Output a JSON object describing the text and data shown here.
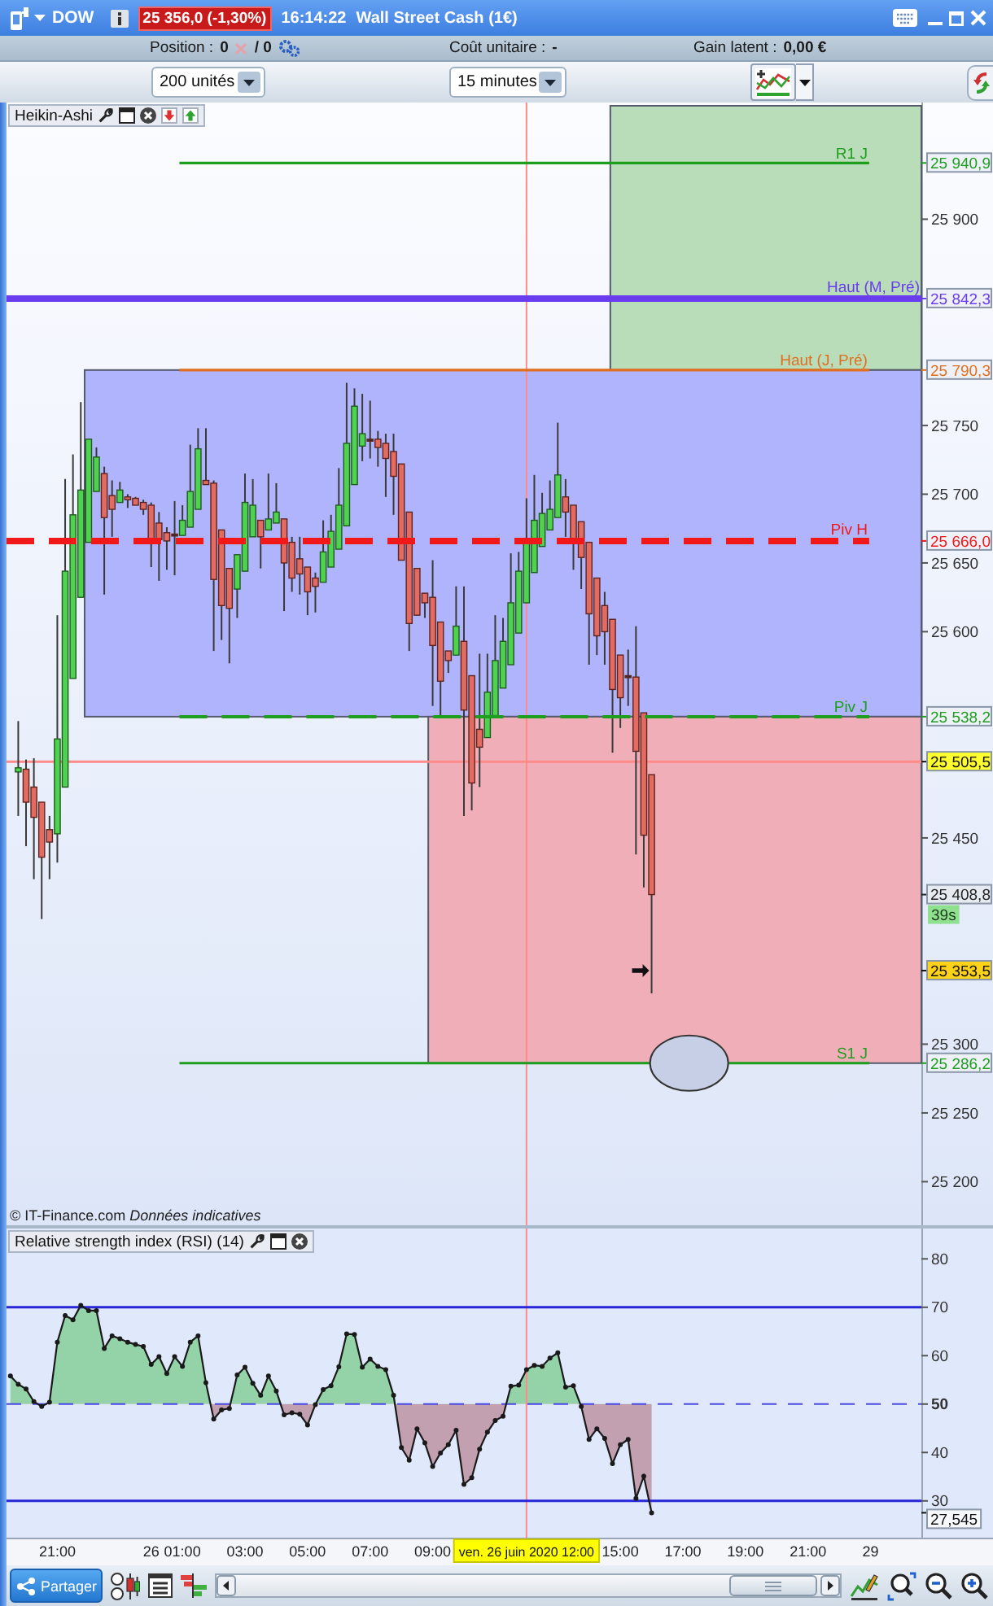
{
  "title_bar": {
    "symbol": "DOW",
    "quote": "25 356,0 (-1,30%)",
    "time": "16:14:22",
    "instrument": "Wall Street Cash (1€)"
  },
  "position_bar": {
    "position_label": "Position :",
    "position_value": "0",
    "position_total": "/ 0",
    "unit_cost_label": "Coût unitaire :",
    "unit_cost_value": "-",
    "gain_label": "Gain latent :",
    "gain_value": "0,00 €"
  },
  "toolbar": {
    "quantity": "200 unités",
    "timeframe": "15 minutes"
  },
  "price_panel": {
    "header": "Heikin-Ashi",
    "notice": "© IT-Finance.com *Données indicatives*",
    "chart_data": {
      "type": "candlestick",
      "ylim": [
        25169.5,
        25982.5
      ],
      "categories": [
        null,
        null,
        null,
        null,
        null,
        null,
        null,
        null,
        null,
        null,
        null,
        null,
        null,
        null,
        null,
        null,
        null,
        null,
        null,
        null,
        null,
        null,
        null,
        null,
        null,
        null,
        null,
        null,
        null,
        null,
        null,
        null,
        null,
        null,
        null,
        null,
        null,
        null,
        null,
        null,
        null,
        null,
        null,
        null,
        null,
        null,
        null,
        null,
        null,
        null,
        null,
        null,
        null,
        null,
        null,
        null,
        null,
        null,
        null,
        null,
        null,
        null,
        null,
        null,
        null,
        null,
        null,
        null,
        null,
        null,
        null,
        null,
        null,
        null,
        null,
        null,
        null,
        null,
        null,
        null,
        null,
        null,
        null,
        null,
        null,
        null,
        null,
        null,
        null,
        null,
        null,
        null,
        null,
        null,
        null,
        null,
        null,
        null,
        null,
        null,
        null,
        null,
        null,
        null,
        null,
        null,
        null,
        null,
        null,
        null,
        null,
        null,
        null,
        null,
        null,
        null,
        null
      ],
      "yticks": [
        {
          "value": 25940.9,
          "label": "25 940,9"
        },
        {
          "value": 25900,
          "label": "25 900"
        },
        {
          "value": 25842.3,
          "label": "25 842,3"
        },
        {
          "value": 25790.3,
          "label": "25 790,3"
        },
        {
          "value": 25750,
          "label": "25 750"
        },
        {
          "value": 25700,
          "label": "25 700"
        },
        {
          "value": 25666.0,
          "label": "25 666,0"
        },
        {
          "value": 25650,
          "label": "25 650"
        },
        {
          "value": 25600,
          "label": "25 600"
        },
        {
          "value": 25538.2,
          "label": "25 538,2"
        },
        {
          "value": 25505.5,
          "label": "25 505,5"
        },
        {
          "value": 25450,
          "label": "25 450"
        },
        {
          "value": 25408.8,
          "label": "25 408,8"
        },
        {
          "value": 25353.5,
          "label": "25 353,5"
        },
        {
          "value": 25300,
          "label": "25 300"
        },
        {
          "value": 25286.2,
          "label": "25 286,2"
        },
        {
          "value": 25250,
          "label": "25 250"
        },
        {
          "value": 25200,
          "label": "25 200"
        }
      ],
      "ohlc": [
        null,
        [
          25498,
          25535,
          25466,
          25501
        ],
        [
          25500,
          25507,
          25444,
          25476
        ],
        [
          25487,
          25508,
          25420,
          25465
        ],
        [
          25476,
          25476,
          25391,
          25436
        ],
        [
          25456,
          25466,
          25420,
          25447
        ],
        [
          25453,
          25612,
          25432,
          25522
        ],
        [
          25487,
          25711,
          25487,
          25644
        ],
        [
          25566,
          25729,
          25566,
          25685
        ],
        [
          25625,
          25767,
          25625,
          25703
        ],
        [
          25665,
          25740,
          25665,
          25740
        ],
        [
          25702,
          25734,
          25702,
          25727
        ],
        [
          25715,
          25720,
          25627,
          25683
        ],
        [
          25699,
          25710,
          25669,
          25689
        ],
        [
          25694,
          25709,
          25694,
          25703
        ],
        [
          25698,
          25700,
          25690,
          25696
        ],
        [
          25697,
          25698,
          25692,
          25692
        ],
        [
          25694,
          25696,
          25685,
          25689
        ],
        [
          25692,
          25694,
          25647,
          25667
        ],
        [
          25679,
          25687,
          25637,
          25667
        ],
        [
          25672,
          25676,
          25645,
          25666
        ],
        [
          25671,
          25695,
          25641,
          25670
        ],
        [
          25670,
          25692,
          25670,
          25681
        ],
        [
          25676,
          25736,
          25676,
          25702
        ],
        [
          25689,
          25748,
          25689,
          25733
        ],
        [
          25710,
          25748,
          25707,
          25707
        ],
        [
          25708,
          25710,
          25586,
          25638
        ],
        [
          25674,
          25674,
          25594,
          25619
        ],
        [
          25646,
          25646,
          25577,
          25617
        ],
        [
          25631,
          25656,
          25610,
          25656
        ],
        [
          25644,
          25715,
          25644,
          25694
        ],
        [
          25669,
          25711,
          25669,
          25692
        ],
        [
          25681,
          25681,
          25646,
          25669
        ],
        [
          25674,
          25715,
          25674,
          25682
        ],
        [
          25679,
          25708,
          25679,
          25687
        ],
        [
          25682,
          25682,
          25615,
          25650
        ],
        [
          25665,
          25669,
          25629,
          25639
        ],
        [
          25653,
          25669,
          25627,
          25642
        ],
        [
          25647,
          25647,
          25612,
          25629
        ],
        [
          25639,
          25643,
          25614,
          25633
        ],
        [
          25636,
          25681,
          25636,
          25658
        ],
        [
          25647,
          25685,
          25647,
          25673
        ],
        [
          25660,
          25719,
          25660,
          25692
        ],
        [
          25677,
          25781,
          25677,
          25737
        ],
        [
          25707,
          25777,
          25707,
          25764
        ],
        [
          25735,
          25773,
          25724,
          25744
        ],
        [
          25740,
          25768,
          25726,
          25739
        ],
        [
          25740,
          25746,
          25720,
          25734
        ],
        [
          25737,
          25744,
          25698,
          25726
        ],
        [
          25731,
          25744,
          25685,
          25713
        ],
        [
          25722,
          25722,
          25652,
          25652
        ],
        [
          25687,
          25687,
          25586,
          25606
        ],
        [
          25646,
          25646,
          25612,
          25612
        ],
        [
          25628,
          25628,
          25610,
          25621
        ],
        [
          25625,
          25652,
          25546,
          25590
        ],
        [
          25607,
          25607,
          25539,
          25564
        ],
        [
          25586,
          25586,
          25570,
          25579
        ],
        [
          25583,
          25633,
          25583,
          25604
        ],
        [
          25593,
          25633,
          25466,
          25543
        ],
        [
          25568,
          25568,
          25470,
          25490
        ],
        [
          25529,
          25584,
          25487,
          25516
        ],
        [
          25523,
          25584,
          25523,
          25556
        ],
        [
          25539,
          25612,
          25539,
          25579
        ],
        [
          25559,
          25610,
          25559,
          25593
        ],
        [
          25576,
          25657,
          25576,
          25621
        ],
        [
          25599,
          25658,
          25599,
          25644
        ],
        [
          25621,
          25697,
          25621,
          25666
        ],
        [
          25643,
          25714,
          25643,
          25681
        ],
        [
          25662,
          25701,
          25662,
          25686
        ],
        [
          25674,
          25710,
          25674,
          25689
        ],
        [
          25683,
          25752,
          25683,
          25714
        ],
        [
          25698,
          25711,
          25669,
          25687
        ],
        [
          25692,
          25692,
          25645,
          25666
        ],
        [
          25680,
          25680,
          25631,
          25654
        ],
        [
          25665,
          25665,
          25576,
          25613
        ],
        [
          25639,
          25639,
          25583,
          25597
        ],
        [
          25619,
          25629,
          25576,
          25600
        ],
        [
          25609,
          25609,
          25512,
          25558
        ],
        [
          25583,
          25583,
          25530,
          25552
        ],
        [
          25568,
          25587,
          25546,
          25567
        ],
        [
          25567,
          25604,
          25438,
          25513
        ],
        [
          25541,
          25541,
          25414,
          25452
        ],
        [
          25496,
          25496,
          25337,
          25408.8
        ],
        null,
        null,
        null,
        null,
        null,
        null,
        null,
        null,
        null,
        null,
        null,
        null,
        null,
        null,
        null,
        null,
        null,
        null,
        null,
        null,
        null,
        null,
        null,
        null,
        null,
        null,
        null,
        null,
        null,
        null,
        null,
        null,
        null,
        null
      ],
      "bands": [
        {
          "axis": "y",
          "from": 25790.3,
          "to": 25982.5,
          "color": "#b9dcb9"
        },
        {
          "axis": "y",
          "from": 25538.2,
          "to": 25790.3,
          "color": "#b0b4fc"
        },
        {
          "axis": "y",
          "from": 25286.2,
          "to": 25538.2,
          "color": "#f0afb8"
        }
      ],
      "ref_lines": [
        {
          "axis": "y",
          "value": 25940.9,
          "label": "R1 J",
          "color": "#1e9e1e"
        },
        {
          "axis": "y",
          "value": 25842.3,
          "label": "Haut (M, Pré)",
          "color": "#6a3cf0"
        },
        {
          "axis": "y",
          "value": 25790.3,
          "label": "Haut (J, Pré)",
          "color": "#e07020"
        },
        {
          "axis": "y",
          "value": 25666.0,
          "label": "Piv H",
          "color": "#f01818"
        },
        {
          "axis": "y",
          "value": 25538.2,
          "label": "Piv J",
          "color": "#1e9e1e"
        },
        {
          "axis": "y",
          "value": 25286.2,
          "label": "S1 J",
          "color": "#1e9e1e"
        },
        {
          "axis": "y",
          "value": 25505.5,
          "color": "#ff8a8a"
        }
      ],
      "annotations": [
        "39s"
      ]
    }
  },
  "rsi_panel": {
    "header": "Relative strength index (RSI) (14)",
    "chart_data": {
      "type": "line",
      "ylim": [
        22.4,
        85.6
      ],
      "categories": [
        null,
        null,
        null,
        null,
        null,
        null,
        "21:00",
        null,
        null,
        null,
        null,
        null,
        null,
        null,
        null,
        null,
        null,
        null,
        "26",
        null,
        null,
        null,
        "01:00",
        null,
        null,
        null,
        null,
        null,
        null,
        null,
        "03:00",
        null,
        null,
        null,
        null,
        null,
        null,
        null,
        "05:00",
        null,
        null,
        null,
        null,
        null,
        null,
        null,
        "07:00",
        null,
        null,
        null,
        null,
        null,
        null,
        null,
        "09:00",
        null,
        null,
        null,
        null,
        null,
        null,
        null,
        null,
        null,
        null,
        null,
        "ven. 26 juin 2020 12:00",
        null,
        null,
        null,
        null,
        null,
        null,
        null,
        null,
        null,
        null,
        null,
        "15:00",
        null,
        null,
        null,
        null,
        null,
        null,
        null,
        "17:00",
        null,
        null,
        null,
        null,
        null,
        null,
        null,
        "19:00",
        null,
        null,
        null,
        null,
        null,
        null,
        null,
        "21:00",
        null,
        null,
        null,
        null,
        null,
        null,
        null,
        "29",
        null,
        null,
        null,
        null,
        null,
        null
      ],
      "yticks": [
        {
          "value": 80,
          "label": "80"
        },
        {
          "value": 70,
          "label": "70"
        },
        {
          "value": 60,
          "label": "60"
        },
        {
          "value": 50,
          "label": "50"
        },
        {
          "value": 40,
          "label": "40"
        },
        {
          "value": 30,
          "label": "30"
        }
      ],
      "series": [
        {
          "color": "#1a1a1a",
          "marker": "o",
          "values": [
            55.8,
            54.1,
            53.1,
            50.5,
            49.5,
            50.4,
            62.8,
            68.3,
            67.4,
            70.4,
            69.3,
            69.3,
            61.5,
            64.1,
            63.5,
            62.8,
            62.3,
            61.9,
            58.2,
            59.8,
            56.3,
            59.8,
            57.8,
            62.8,
            64.1,
            54.4,
            46.9,
            48.8,
            49.1,
            56.0,
            57.6,
            54.3,
            51.8,
            55.8,
            52.7,
            47.8,
            48.2,
            47.9,
            45.7,
            49.9,
            53.0,
            53.8,
            57.7,
            64.5,
            64.4,
            57.6,
            59.3,
            57.8,
            57.1,
            51.8,
            41.0,
            38.4,
            44.9,
            42.0,
            37.1,
            39.9,
            41.6,
            44.6,
            33.4,
            34.8,
            40.7,
            44.2,
            46.6,
            47.5,
            53.7,
            53.9,
            57.1,
            58.0,
            57.8,
            59.5,
            60.6,
            53.5,
            53.8,
            49.5,
            42.7,
            44.9,
            42.9,
            37.7,
            41.6,
            42.7,
            30.5,
            35.1,
            27.545,
            null,
            null,
            null,
            null,
            null,
            null,
            null,
            null,
            null,
            null,
            null,
            null,
            null,
            null,
            null,
            null,
            null,
            null,
            null,
            null,
            null,
            null,
            null,
            null,
            null,
            null,
            null,
            null,
            null,
            null,
            null,
            null,
            null,
            null
          ]
        }
      ],
      "ref_lines": [
        {
          "axis": "y",
          "value": 70,
          "color": "#2828d8"
        },
        {
          "axis": "y",
          "value": 50,
          "color": "#4a4ae2"
        },
        {
          "axis": "y",
          "value": 30,
          "color": "#2828d8"
        },
        {
          "axis": "x",
          "value": "ven. 26 juin 2020 12:00",
          "color": "#ff8a8a"
        }
      ],
      "annotations": [
        "27,545"
      ]
    }
  },
  "bottom_toolbar": {
    "share_label": "Partager"
  }
}
